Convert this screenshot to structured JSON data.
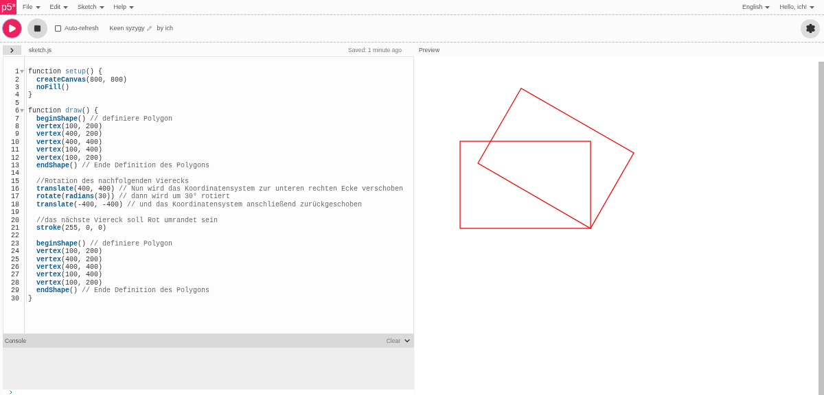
{
  "logo": "p5*",
  "menu": [
    {
      "label": "File"
    },
    {
      "label": "Edit"
    },
    {
      "label": "Sketch"
    },
    {
      "label": "Help"
    }
  ],
  "user_menu": [
    {
      "label": "English"
    },
    {
      "label": "Hello, ich!"
    }
  ],
  "toolbar": {
    "auto_refresh": {
      "label": "Auto-refresh",
      "checked": false
    },
    "sketch_name": "Keen syzygy",
    "author": "by ich"
  },
  "editor": {
    "file_name": "sketch.js",
    "saved": "Saved: 1 minute ago",
    "lines": [
      {
        "number": "1",
        "foldable": true,
        "indented": false,
        "tokens": [
          {
            "kind": "plain",
            "text": "function "
          },
          {
            "kind": "def",
            "text": "setup"
          },
          {
            "kind": "plain",
            "text": "() {"
          }
        ]
      },
      {
        "number": "2",
        "foldable": false,
        "indented": true,
        "tokens": [
          {
            "kind": "builtin",
            "text": "createCanvas"
          },
          {
            "kind": "plain",
            "text": "(800, 800)"
          }
        ]
      },
      {
        "number": "3",
        "foldable": false,
        "indented": true,
        "tokens": [
          {
            "kind": "builtin",
            "text": "noFill"
          },
          {
            "kind": "plain",
            "text": "()"
          }
        ]
      },
      {
        "number": "4",
        "foldable": false,
        "indented": false,
        "tokens": [
          {
            "kind": "plain",
            "text": "}"
          }
        ]
      },
      {
        "number": "5",
        "foldable": false
      },
      {
        "number": "6",
        "foldable": true,
        "indented": false,
        "tokens": [
          {
            "kind": "plain",
            "text": "function "
          },
          {
            "kind": "def",
            "text": "draw"
          },
          {
            "kind": "plain",
            "text": "() {"
          }
        ]
      },
      {
        "number": "7",
        "foldable": false,
        "indented": true,
        "tokens": [
          {
            "kind": "builtin",
            "text": "beginShape"
          },
          {
            "kind": "plain",
            "text": "() "
          },
          {
            "kind": "comment",
            "text": "// definiere Polygon"
          }
        ]
      },
      {
        "number": "8",
        "foldable": false,
        "indented": true,
        "tokens": [
          {
            "kind": "builtin",
            "text": "vertex"
          },
          {
            "kind": "plain",
            "text": "(100, 200)"
          }
        ]
      },
      {
        "number": "9",
        "foldable": false,
        "indented": true,
        "tokens": [
          {
            "kind": "builtin",
            "text": "vertex"
          },
          {
            "kind": "plain",
            "text": "(400, 200)"
          }
        ]
      },
      {
        "number": "10",
        "foldable": false,
        "indented": true,
        "tokens": [
          {
            "kind": "builtin",
            "text": "vertex"
          },
          {
            "kind": "plain",
            "text": "(400, 400)"
          }
        ]
      },
      {
        "number": "11",
        "foldable": false,
        "indented": true,
        "tokens": [
          {
            "kind": "builtin",
            "text": "vertex"
          },
          {
            "kind": "plain",
            "text": "(100, 400)"
          }
        ]
      },
      {
        "number": "12",
        "foldable": false,
        "indented": true,
        "tokens": [
          {
            "kind": "builtin",
            "text": "vertex"
          },
          {
            "kind": "plain",
            "text": "(100, 200)"
          }
        ]
      },
      {
        "number": "13",
        "foldable": false,
        "indented": true,
        "tokens": [
          {
            "kind": "builtin",
            "text": "endShape"
          },
          {
            "kind": "plain",
            "text": "() "
          },
          {
            "kind": "comment",
            "text": "// Ende Definition des Polygons"
          }
        ]
      },
      {
        "number": "14",
        "foldable": false
      },
      {
        "number": "15",
        "foldable": false,
        "indented": true,
        "tokens": [
          {
            "kind": "comment",
            "text": "//Rotation des nachfolgenden Vierecks"
          }
        ]
      },
      {
        "number": "16",
        "foldable": false,
        "indented": true,
        "tokens": [
          {
            "kind": "builtin",
            "text": "translate"
          },
          {
            "kind": "plain",
            "text": "(400, 400) "
          },
          {
            "kind": "comment",
            "text": "// Nun wird das Koordinatensystem zur unteren rechten Ecke verschoben"
          }
        ]
      },
      {
        "number": "17",
        "foldable": false,
        "indented": true,
        "tokens": [
          {
            "kind": "builtin",
            "text": "rotate"
          },
          {
            "kind": "plain",
            "text": "("
          },
          {
            "kind": "builtin",
            "text": "radians"
          },
          {
            "kind": "plain",
            "text": "(30)) "
          },
          {
            "kind": "comment",
            "text": "// dann wird um 30° rotiert"
          }
        ]
      },
      {
        "number": "18",
        "foldable": false,
        "indented": true,
        "tokens": [
          {
            "kind": "builtin",
            "text": "translate"
          },
          {
            "kind": "plain",
            "text": "(-400, -400) "
          },
          {
            "kind": "comment",
            "text": "// und das Koordinatensystem anschließend zurückgeschoben"
          }
        ]
      },
      {
        "number": "19",
        "foldable": false
      },
      {
        "number": "20",
        "foldable": false,
        "indented": true,
        "tokens": [
          {
            "kind": "comment",
            "text": "//das nächste Viereck soll Rot umrandet sein"
          }
        ]
      },
      {
        "number": "21",
        "foldable": false,
        "indented": true,
        "tokens": [
          {
            "kind": "builtin",
            "text": "stroke"
          },
          {
            "kind": "plain",
            "text": "(255, 0, 0)"
          }
        ]
      },
      {
        "number": "22",
        "foldable": false
      },
      {
        "number": "23",
        "foldable": false,
        "indented": true,
        "tokens": [
          {
            "kind": "builtin",
            "text": "beginShape"
          },
          {
            "kind": "plain",
            "text": "() "
          },
          {
            "kind": "comment",
            "text": "// definiere Polygon"
          }
        ]
      },
      {
        "number": "24",
        "foldable": false,
        "indented": true,
        "tokens": [
          {
            "kind": "builtin",
            "text": "vertex"
          },
          {
            "kind": "plain",
            "text": "(100, 200)"
          }
        ]
      },
      {
        "number": "25",
        "foldable": false,
        "indented": true,
        "tokens": [
          {
            "kind": "builtin",
            "text": "vertex"
          },
          {
            "kind": "plain",
            "text": "(400, 200)"
          }
        ]
      },
      {
        "number": "26",
        "foldable": false,
        "indented": true,
        "tokens": [
          {
            "kind": "builtin",
            "text": "vertex"
          },
          {
            "kind": "plain",
            "text": "(400, 400)"
          }
        ]
      },
      {
        "number": "27",
        "foldable": false,
        "indented": true,
        "tokens": [
          {
            "kind": "builtin",
            "text": "vertex"
          },
          {
            "kind": "plain",
            "text": "(100, 400)"
          }
        ]
      },
      {
        "number": "28",
        "foldable": false,
        "indented": true,
        "tokens": [
          {
            "kind": "builtin",
            "text": "vertex"
          },
          {
            "kind": "plain",
            "text": "(100, 200)"
          }
        ]
      },
      {
        "number": "29",
        "foldable": false,
        "indented": true,
        "tokens": [
          {
            "kind": "builtin",
            "text": "endShape"
          },
          {
            "kind": "plain",
            "text": "() "
          },
          {
            "kind": "comment",
            "text": "// Ende Definition des Polygons"
          }
        ]
      },
      {
        "number": "30",
        "foldable": false,
        "indented": false,
        "tokens": [
          {
            "kind": "plain",
            "text": "}"
          }
        ]
      }
    ]
  },
  "console": {
    "title": "Console",
    "clear": "Clear"
  },
  "preview": {
    "title": "Preview"
  }
}
